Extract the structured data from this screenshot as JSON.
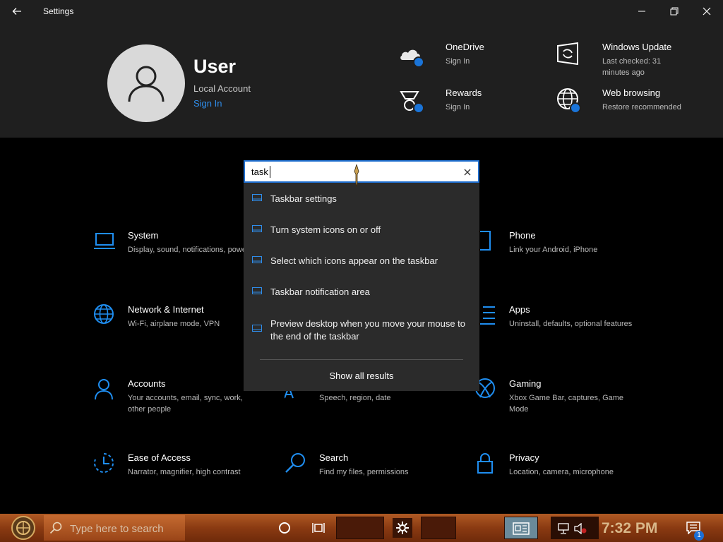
{
  "window": {
    "title": "Settings",
    "back_icon": "arrow-left-icon",
    "minimize_icon": "minimize-icon",
    "maximize_icon": "restore-icon",
    "close_icon": "close-icon"
  },
  "user": {
    "name": "User",
    "account_type": "Local Account",
    "sign_in_label": "Sign In"
  },
  "header_items": [
    {
      "title": "OneDrive",
      "subtitle": "Sign In",
      "icon": "onedrive-icon"
    },
    {
      "title": "Rewards",
      "subtitle": "Sign In",
      "icon": "rewards-icon"
    },
    {
      "title": "Windows Update",
      "subtitle": "Last checked: 31 minutes ago",
      "icon": "windows-update-icon"
    },
    {
      "title": "Web browsing",
      "subtitle": "Restore recommended",
      "icon": "globe-icon"
    }
  ],
  "search": {
    "value": "task",
    "clear_icon": "clear-icon",
    "suggestions": [
      "Taskbar settings",
      "Turn system icons on or off",
      "Select which icons appear on the taskbar",
      "Taskbar notification area",
      "Preview desktop when you move your mouse to the end of the taskbar"
    ],
    "show_all_label": "Show all results"
  },
  "categories": [
    {
      "title": "System",
      "subtitle": "Display, sound, notifications, power",
      "icon": "laptop-icon"
    },
    {
      "title": "Phone",
      "subtitle": "Link your Android, iPhone",
      "icon": "phone-icon"
    },
    {
      "title": "Network & Internet",
      "subtitle": "Wi-Fi, airplane mode, VPN",
      "icon": "globe-icon"
    },
    {
      "title": "Apps",
      "subtitle": "Uninstall, defaults, optional features",
      "icon": "apps-icon"
    },
    {
      "title": "Accounts",
      "subtitle": "Your accounts, email, sync, work, other people",
      "icon": "person-icon"
    },
    {
      "title": "",
      "subtitle": "Speech, region, date",
      "icon": "time-language-icon"
    },
    {
      "title": "Gaming",
      "subtitle": "Xbox Game Bar, captures, Game Mode",
      "icon": "xbox-icon"
    },
    {
      "title": "Ease of Access",
      "subtitle": "Narrator, magnifier, high contrast",
      "icon": "ease-of-access-icon"
    },
    {
      "title": "Search",
      "subtitle": "Find my files, permissions",
      "icon": "search-icon"
    },
    {
      "title": "Privacy",
      "subtitle": "Location, camera, microphone",
      "icon": "lock-icon"
    }
  ],
  "taskbar": {
    "search_placeholder": "Type here to search",
    "clock": "7:32 PM",
    "notification_count": "1",
    "icons": [
      "start-icon",
      "search-icon",
      "cortana-icon",
      "task-view-icon",
      "settings-icon",
      "news-icon",
      "network-icon",
      "volume-muted-icon",
      "action-center-icon"
    ]
  },
  "colors": {
    "accent": "#2f8dea",
    "background": "#000000",
    "header_background": "#1f1f1f",
    "dropdown_background": "#2b2b2b"
  }
}
